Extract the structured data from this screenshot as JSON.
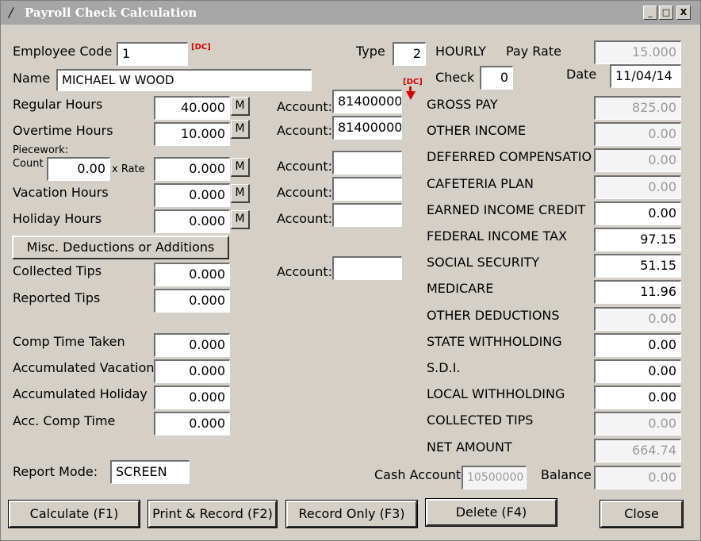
{
  "window": {
    "title": "Payroll Check Calculation",
    "min_glyph": "_",
    "max_glyph": "□",
    "close_glyph": "X",
    "app_icon_glyph": "/"
  },
  "employee": {
    "code_label": "Employee Code",
    "code_value": "1",
    "code_dc": "[DC]",
    "name_label": "Name",
    "name_value": "MICHAEL W WOOD",
    "type_label": "Type",
    "type_value": "2",
    "type_text": "HOURLY",
    "payrate_label": "Pay Rate",
    "payrate_value": "15.000",
    "check_label": "Check",
    "check_value": "0",
    "date_label": "Date",
    "date_value": "11/04/14"
  },
  "hours": {
    "regular_label": "Regular Hours",
    "regular_value": "40.000",
    "overtime_label": "Overtime Hours",
    "overtime_value": "10.000",
    "piecework_label": "Piecework:",
    "count_label": "Count",
    "count_value": "0.00",
    "xrate_label": "x Rate",
    "rate_value": "0.000",
    "vacation_label": "Vacation Hours",
    "vacation_value": "0.000",
    "holiday_label": "Holiday Hours",
    "holiday_value": "0.000",
    "m_label": "M"
  },
  "misc_button": "Misc. Deductions or Additions",
  "tips": {
    "collected_label": "Collected Tips",
    "collected_value": "0.000",
    "reported_label": "Reported Tips",
    "reported_value": "0.000"
  },
  "accum": {
    "comp_taken_label": "Comp Time Taken",
    "comp_taken_value": "0.000",
    "vacation_label": "Accumulated Vacation",
    "vacation_value": "0.000",
    "holiday_label": "Accumulated Holiday",
    "holiday_value": "0.000",
    "comp_label": "Acc. Comp Time",
    "comp_value": "0.000"
  },
  "accounts": {
    "label": "Account:",
    "regular": "81400000",
    "overtime": "81400000",
    "piecework": "",
    "vacation": "",
    "holiday": "",
    "tips": "",
    "dc": "[DC]"
  },
  "amounts": [
    {
      "label": "GROSS PAY",
      "value": "825.00",
      "enabled": false
    },
    {
      "label": "OTHER INCOME",
      "value": "0.00",
      "enabled": false
    },
    {
      "label": "DEFERRED COMPENSATIO",
      "value": "0.00",
      "enabled": false
    },
    {
      "label": "CAFETERIA PLAN",
      "value": "0.00",
      "enabled": false
    },
    {
      "label": "EARNED INCOME CREDIT",
      "value": "0.00",
      "enabled": true
    },
    {
      "label": "FEDERAL INCOME TAX",
      "value": "97.15",
      "enabled": true
    },
    {
      "label": "SOCIAL SECURITY",
      "value": "51.15",
      "enabled": true
    },
    {
      "label": "MEDICARE",
      "value": "11.96",
      "enabled": true
    },
    {
      "label": "OTHER DEDUCTIONS",
      "value": "0.00",
      "enabled": false
    },
    {
      "label": "STATE WITHHOLDING",
      "value": "0.00",
      "enabled": true
    },
    {
      "label": "S.D.I.",
      "value": "0.00",
      "enabled": true
    },
    {
      "label": "LOCAL WITHHOLDING",
      "value": "0.00",
      "enabled": true
    },
    {
      "label": "COLLECTED TIPS",
      "value": "0.00",
      "enabled": false
    },
    {
      "label": "NET AMOUNT",
      "value": "664.74",
      "enabled": false
    }
  ],
  "report_mode": {
    "label": "Report Mode:",
    "value": "SCREEN"
  },
  "cash": {
    "label": "Cash Account",
    "value": "10500000",
    "balance_label": "Balance",
    "balance_value": "0.00"
  },
  "buttons": {
    "calculate": "Calculate (F1)",
    "print_record": "Print & Record (F2)",
    "record_only": "Record Only (F3)",
    "delete": "Delete (F4)",
    "close": "Close"
  }
}
